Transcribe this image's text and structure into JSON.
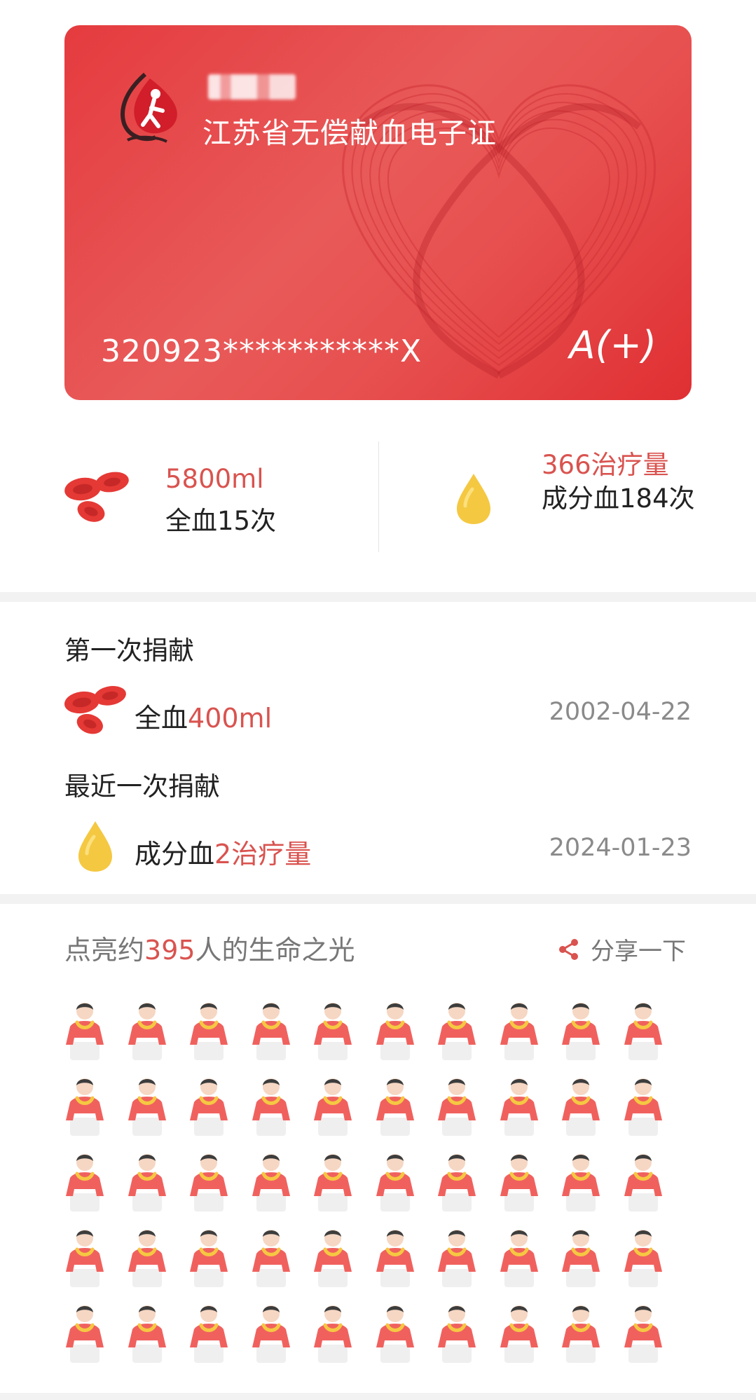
{
  "card": {
    "name_masked": "■■■",
    "title": "江苏省无偿献血电子证",
    "id_number": "320923***********X",
    "blood_type": "A(+)"
  },
  "stats": {
    "whole_blood_volume": "5800ml",
    "whole_blood_count": "全血15次",
    "component_units": "366治疗量",
    "component_count": "成分血184次"
  },
  "first_donation": {
    "heading": "第一次捐献",
    "type": "全血",
    "amount": "400ml",
    "date": "2002-04-22"
  },
  "latest_donation": {
    "heading": "最近一次捐献",
    "type": "成分血",
    "amount": "2治疗量",
    "date": "2024-01-23"
  },
  "lives": {
    "prefix": "点亮约",
    "count": "395",
    "suffix": "人的生命之光",
    "share_label": "分享一下"
  },
  "icons": {
    "whole_blood": "red-blood-cells-icon",
    "component_blood": "yellow-drop-icon",
    "share": "share-icon",
    "person": "person-icon",
    "logo": "blood-donation-logo"
  },
  "colors": {
    "accent_red": "#d9534f",
    "card_red": "#e53b3f",
    "drop_yellow": "#f5c842"
  }
}
